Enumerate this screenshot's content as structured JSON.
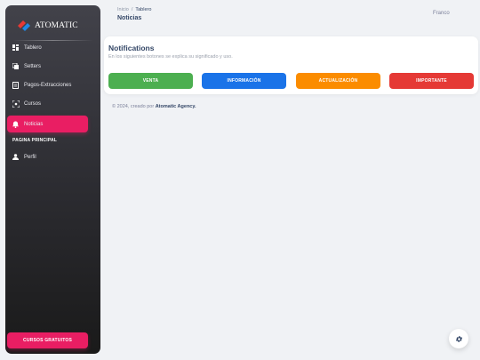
{
  "sidebar": {
    "brand": "ATOMATIC",
    "nav": [
      {
        "label": "Tablero",
        "icon": "dashboard-icon"
      },
      {
        "label": "Setters",
        "icon": "copy-icon"
      },
      {
        "label": "Pagos-Extracciones",
        "icon": "receipt-icon"
      },
      {
        "label": "Cursos",
        "icon": "center-focus-icon"
      },
      {
        "label": "Noticias",
        "icon": "bell-icon",
        "active": true
      }
    ],
    "section_heading": "PAGINA PRINCIPAL",
    "profile": {
      "label": "Perfil",
      "icon": "person-icon"
    },
    "cta": "CURSOS GRATUITOS"
  },
  "header": {
    "breadcrumb": [
      "Inicio",
      "Tablero"
    ],
    "breadcrumb_sep": "/",
    "title": "Noticias",
    "user": "Franco"
  },
  "card": {
    "title": "Notifications",
    "subtitle": "En los siguientes botones se explica su significado y uso.",
    "buttons": [
      {
        "label": "VENTA",
        "color": "#4caf50"
      },
      {
        "label": "INFORMACIÓN",
        "color": "#1a73e8"
      },
      {
        "label": "ACTUALIZACIÓN",
        "color": "#fb8c00"
      },
      {
        "label": "IMPORTANTE",
        "color": "#e53935"
      }
    ]
  },
  "footer": {
    "prefix": "© 2024, creado por",
    "agency": "Atomatic Agency."
  },
  "colors": {
    "accent": "#e91e63",
    "sidebar_dark": "#202024",
    "background": "#f0f2f5"
  }
}
